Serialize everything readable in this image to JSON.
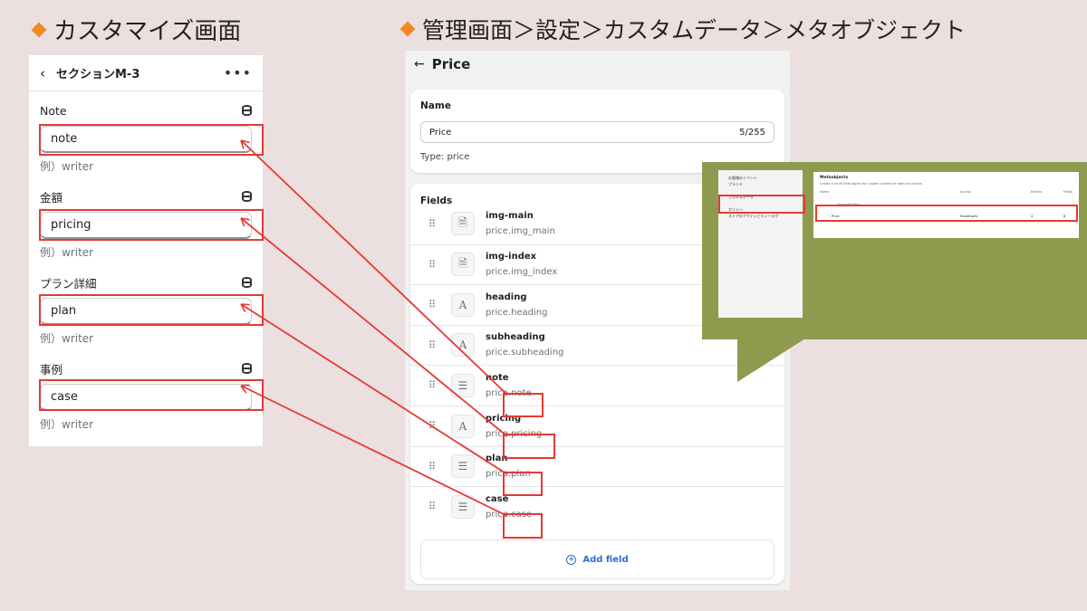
{
  "headings": {
    "left": "カスタマイズ画面",
    "right": "管理画面＞設定＞カスタムデータ＞メタオブジェクト"
  },
  "customize": {
    "back_icon": "chevron-left-icon",
    "title": "セクションM-3",
    "more_icon": "ellipsis-icon",
    "groups": [
      {
        "label": "Note",
        "value": "note",
        "hint": "例）writer"
      },
      {
        "label": "金額",
        "value": "pricing",
        "hint": "例）writer"
      },
      {
        "label": "プラン詳細",
        "value": "plan",
        "hint": "例）writer"
      },
      {
        "label": "事例",
        "value": "case",
        "hint": "例）writer"
      }
    ]
  },
  "admin": {
    "title": "Price",
    "name_label": "Name",
    "name_value": "Price",
    "name_count": "5/255",
    "type_label": "Type:",
    "type_value": "price",
    "fields_label": "Fields",
    "fields": [
      {
        "name": "img-main",
        "key": "price.img_main",
        "icon": "file-icon",
        "glyph": "🗎"
      },
      {
        "name": "img-index",
        "key": "price.img_index",
        "icon": "file-icon",
        "glyph": "🗎"
      },
      {
        "name": "heading",
        "key": "price.heading",
        "icon": "text-icon",
        "glyph": "A"
      },
      {
        "name": "subheading",
        "key": "price.subheading",
        "icon": "text-icon",
        "glyph": "A"
      },
      {
        "name": "note",
        "key": "price.note",
        "icon": "paragraph-icon",
        "glyph": "☰"
      },
      {
        "name": "pricing",
        "key": "price.pricing",
        "icon": "text-icon",
        "glyph": "A"
      },
      {
        "name": "plan",
        "key": "price.plan",
        "icon": "paragraph-icon",
        "glyph": "☰"
      },
      {
        "name": "case",
        "key": "price.case",
        "icon": "paragraph-icon",
        "glyph": "☰"
      }
    ],
    "add_field": "Add field"
  },
  "inset": {
    "nav_items": [
      "お客様のイベント",
      "ブランド",
      "",
      "カスタムデータ",
      "",
      "ポリシー",
      "ストアのアクティビティーログ"
    ],
    "title": "Metaobjects",
    "subtitle": "Create a multi-field object for custom content or data structures.",
    "columns": [
      "Name",
      "Access",
      "Entries",
      "Fields"
    ],
    "add_row": "Add definition",
    "row": {
      "name": "Price",
      "access": "Storefronts",
      "entries": "4",
      "fields": "8"
    }
  },
  "colors": {
    "highlight": "#e53935",
    "callout": "#8e9b4f",
    "bullet": "#f08a24",
    "link": "#2c6ecb"
  }
}
